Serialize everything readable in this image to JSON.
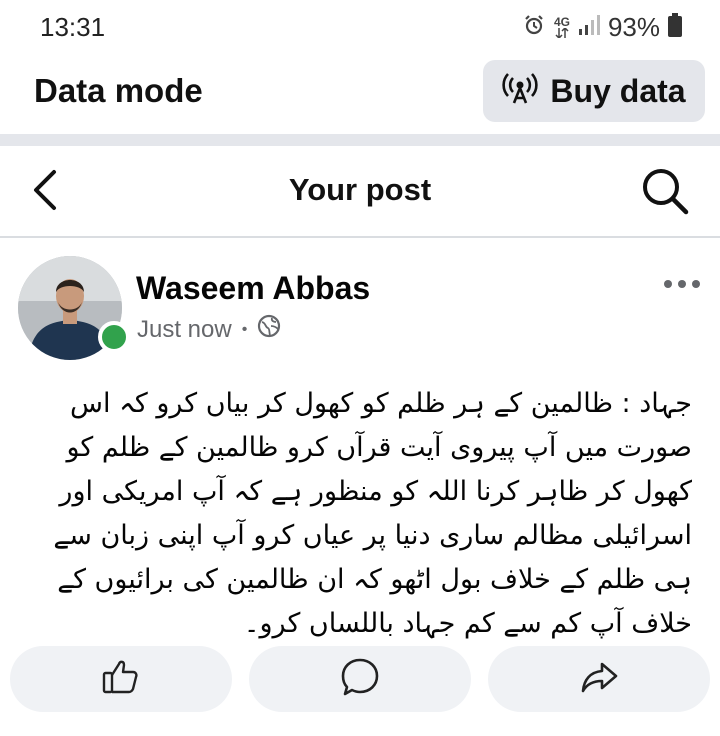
{
  "status_bar": {
    "time": "13:31",
    "network": "4G",
    "battery": "93%",
    "icons": [
      "alarm-icon",
      "network-4g-icon",
      "signal-icon",
      "battery-icon"
    ]
  },
  "data_mode": {
    "title": "Data mode",
    "buy_label": "Buy data",
    "buy_icon": "broadcast-icon"
  },
  "header": {
    "title": "Your post",
    "back_icon": "back-chevron-icon",
    "search_icon": "search-icon"
  },
  "post": {
    "author": "Waseem Abbas",
    "timestamp": "Just now",
    "separator": "•",
    "privacy_icon": "globe-icon",
    "online": true,
    "text": "جہاد : ظالمین کے ہر ظلم کو کھول کر بیاں کرو کہ اس صورت میں آپ پیروی آیت قرآں کرو ظالمین کے ظلم کو کھول کر ظاہر کرنا اللہ کو منظور ہے کہ آپ امریکی اور اسرائیلی مظالم ساری دنیا پر عیاں کرو آپ اپنی زبان سے ہی ظلم کے خلاف بول اٹھو کہ ان ظالمین کی برائیوں کے خلاف آپ کم سے کم جہاد باللساں کرو۔"
  },
  "actions": {
    "like_icon": "thumbs-up-icon",
    "comment_icon": "comment-icon",
    "share_icon": "share-icon"
  },
  "colors": {
    "online": "#31a24c",
    "action_bg": "#f0f2f5",
    "secondary_text": "#65676b"
  }
}
